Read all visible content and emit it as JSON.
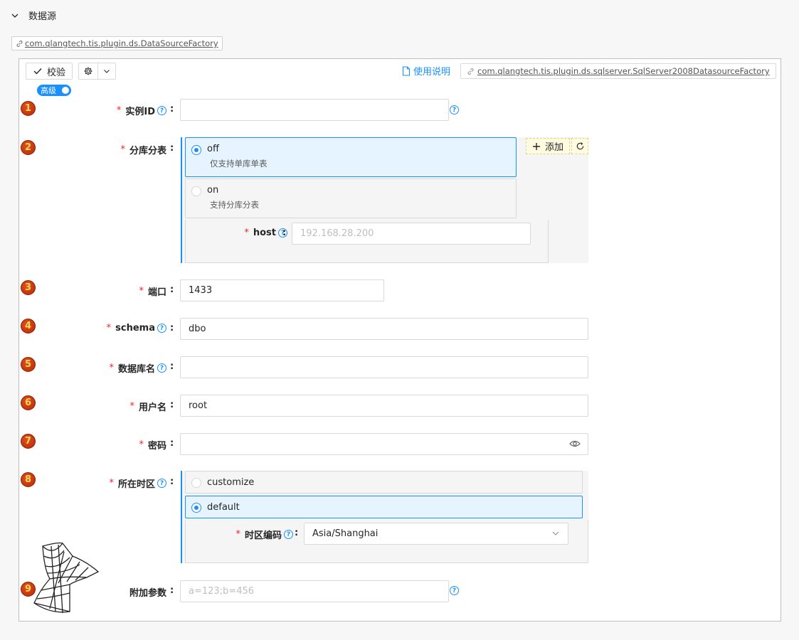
{
  "section": {
    "title": "数据源"
  },
  "factory_tag": "com.qlangtech.tis.plugin.ds.DataSourceFactory",
  "toolbar": {
    "verify_label": "校验",
    "help_label": "使用说明",
    "impl_tag": "com.qlangtech.tis.plugin.ds.sqlserver.SqlServer2008DatasourceFactory"
  },
  "advanced_switch": {
    "label": "高级",
    "on": true
  },
  "fields": {
    "instance_id": {
      "num": "1",
      "label": "实例ID",
      "value": ""
    },
    "split": {
      "num": "2",
      "label": "分库分表",
      "add_label": "添加",
      "options": [
        {
          "title": "off",
          "desc": "仅支持单库单表",
          "selected": true
        },
        {
          "title": "on",
          "desc": "支持分库分表",
          "selected": false
        }
      ],
      "host_label": "host",
      "host_placeholder": "192.168.28.200"
    },
    "port": {
      "num": "3",
      "label": "端口",
      "value": "1433"
    },
    "schema": {
      "num": "4",
      "label": "schema",
      "value": "dbo"
    },
    "dbname": {
      "num": "5",
      "label": "数据库名",
      "value": ""
    },
    "username": {
      "num": "6",
      "label": "用户名",
      "value": "root"
    },
    "password": {
      "num": "7",
      "label": "密码",
      "value": ""
    },
    "timezone": {
      "num": "8",
      "label": "所在时区",
      "options": [
        {
          "title": "customize",
          "selected": false
        },
        {
          "title": "default",
          "selected": true
        }
      ],
      "tz_label": "时区编码",
      "tz_value": "Asia/Shanghai"
    },
    "extra": {
      "num": "9",
      "label": "附加参数",
      "placeholder": "a=123;b=456"
    }
  },
  "colors": {
    "accent": "#1890ff",
    "required": "#f5222d"
  }
}
